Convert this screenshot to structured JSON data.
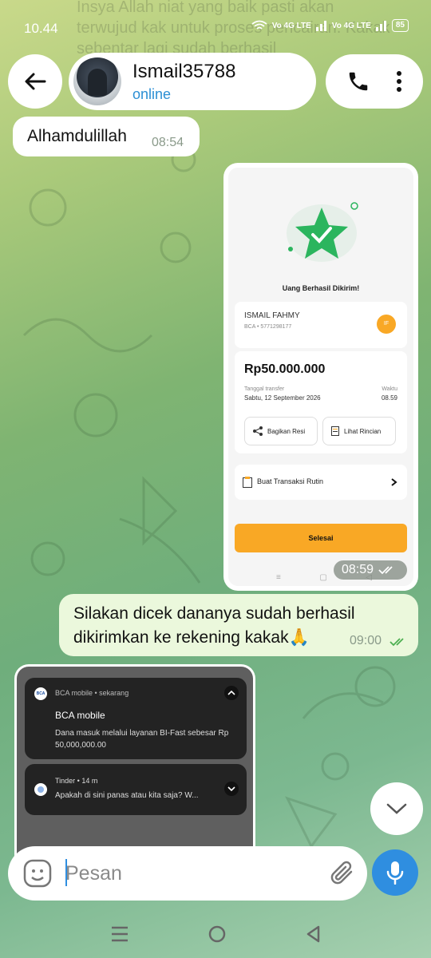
{
  "status_bar": {
    "time": "10.44",
    "network_1": "Vo 4G LTE",
    "network_2": "Vo 4G LTE",
    "battery": "85"
  },
  "background_text": "Insya Allah niat yang baik pasti akan terwujud kak untuk proses pencairan. Kakak sebentar lagi sudah berhasil",
  "header": {
    "contact_name": "Ismail35788",
    "contact_status": "online"
  },
  "messages": [
    {
      "text": "Alhamdulillah",
      "time": "08:54",
      "direction": "in"
    },
    {
      "type": "image",
      "time": "08:59",
      "direction": "out"
    },
    {
      "text": "Silakan dicek dananya sudah berhasil dikirimkan ke rekening kakak🙏",
      "time": "09:00",
      "direction": "out"
    }
  ],
  "receipt": {
    "title": "Uang Berhasil Dikirim!",
    "recipient_name": "ISMAIL FAHMY",
    "recipient_account": "BCA • 5771298177",
    "recipient_initials": "IF",
    "amount": "Rp50.000.000",
    "date_label": "Tanggal transfer",
    "date_value": "Sabtu, 12 September 2026",
    "time_label": "Waktu",
    "time_value": "08.59",
    "share_label": "Bagikan Resi",
    "details_label": "Lihat Rincian",
    "routine_label": "Buat Transaksi Rutin",
    "done_label": "Selesai",
    "accent_color": "#f9a825",
    "success_color": "#2bb55e"
  },
  "notifications": [
    {
      "app": "BCA mobile • sekarang",
      "title": "BCA mobile",
      "body": "Dana masuk melalui layanan BI-Fast sebesar Rp 50,000,000.00"
    },
    {
      "app": "Tinder • 14 m",
      "body": "Apakah di sini panas atau kita saja? W..."
    }
  ],
  "composer": {
    "placeholder": "Pesan"
  }
}
